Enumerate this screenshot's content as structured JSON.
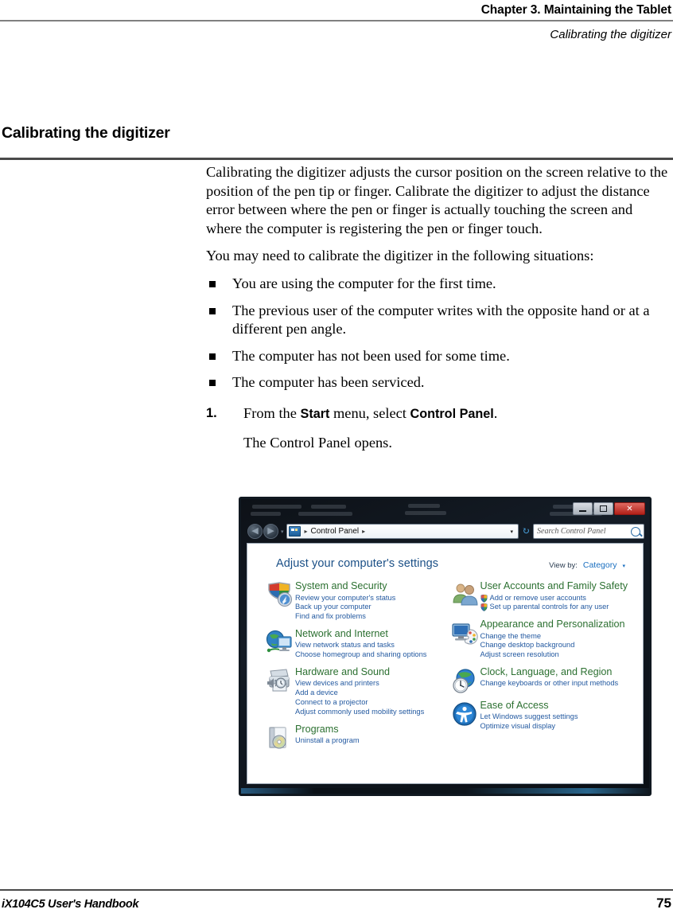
{
  "header": {
    "chapter": "Chapter 3. Maintaining the Tablet",
    "section_running": "Calibrating the digitizer"
  },
  "section": {
    "heading": "Calibrating the digitizer"
  },
  "body": {
    "intro_paragraph": "Calibrating the digitizer adjusts the cursor position on the screen relative to the position of the pen tip or finger. Calibrate the digitizer to adjust the distance error between where the pen or finger is actually touching the screen and where the computer is registering the pen or finger touch.",
    "lead_in": "You may need to calibrate the digitizer in the following situations:",
    "bullets": [
      "You are using the computer for the first time.",
      "The previous user of the computer writes with the opposite hand or at a different pen angle.",
      "The computer has not been used for some time.",
      "The computer has been serviced."
    ],
    "step": {
      "number": "1.",
      "text_before": "From the ",
      "bold_one": "Start",
      "text_middle": " menu, select ",
      "bold_two": "Control Panel",
      "text_after": ".",
      "result": "The Control Panel opens."
    }
  },
  "screenshot": {
    "window_controls": {
      "minimize": "–",
      "maximize": "□",
      "close": "✕"
    },
    "nav": {
      "back_glyph": "◀",
      "forward_glyph": "▶",
      "history_caret": "▾",
      "breadcrumb": [
        "Control Panel"
      ],
      "breadcrumb_separator": "▸",
      "address_caret": "▾",
      "refresh_glyph": "↻",
      "search_placeholder": "Search Control Panel"
    },
    "pane": {
      "title": "Adjust your computer's settings",
      "view_by_label": "View by:",
      "view_by_value": "Category",
      "view_by_caret": "▾"
    },
    "categories_left": [
      {
        "icon": "shield-globe-icon",
        "title": "System and Security",
        "links": [
          {
            "text": "Review your computer's status",
            "shield": false
          },
          {
            "text": "Back up your computer",
            "shield": false
          },
          {
            "text": "Find and fix problems",
            "shield": false
          }
        ]
      },
      {
        "icon": "globe-monitor-icon",
        "title": "Network and Internet",
        "links": [
          {
            "text": "View network status and tasks",
            "shield": false
          },
          {
            "text": "Choose homegroup and sharing options",
            "shield": false
          }
        ]
      },
      {
        "icon": "printer-speaker-icon",
        "title": "Hardware and Sound",
        "links": [
          {
            "text": "View devices and printers",
            "shield": false
          },
          {
            "text": "Add a device",
            "shield": false
          },
          {
            "text": "Connect to a projector",
            "shield": false
          },
          {
            "text": "Adjust commonly used mobility settings",
            "shield": false
          }
        ]
      },
      {
        "icon": "programs-disc-icon",
        "title": "Programs",
        "links": [
          {
            "text": "Uninstall a program",
            "shield": false
          }
        ]
      }
    ],
    "categories_right": [
      {
        "icon": "users-icon",
        "title": "User Accounts and Family Safety",
        "links": [
          {
            "text": "Add or remove user accounts",
            "shield": true
          },
          {
            "text": "Set up parental controls for any user",
            "shield": true
          }
        ]
      },
      {
        "icon": "monitor-palette-icon",
        "title": "Appearance and Personalization",
        "links": [
          {
            "text": "Change the theme",
            "shield": false
          },
          {
            "text": "Change desktop background",
            "shield": false
          },
          {
            "text": "Adjust screen resolution",
            "shield": false
          }
        ]
      },
      {
        "icon": "clock-globe-icon",
        "title": "Clock, Language, and Region",
        "links": [
          {
            "text": "Change keyboards or other input methods",
            "shield": false
          }
        ]
      },
      {
        "icon": "ease-of-access-icon",
        "title": "Ease of Access",
        "links": [
          {
            "text": "Let Windows suggest settings",
            "shield": false
          },
          {
            "text": "Optimize visual display",
            "shield": false
          }
        ]
      }
    ]
  },
  "footer": {
    "book": "iX104C5 User's Handbook",
    "page": "75"
  },
  "colors": {
    "category_title": "#2c7031",
    "category_link": "#2359a0",
    "pane_title": "#1a4f86",
    "rule_gray": "#808080",
    "rule_dark": "#4a4a4a",
    "close_button": "#b12018"
  }
}
